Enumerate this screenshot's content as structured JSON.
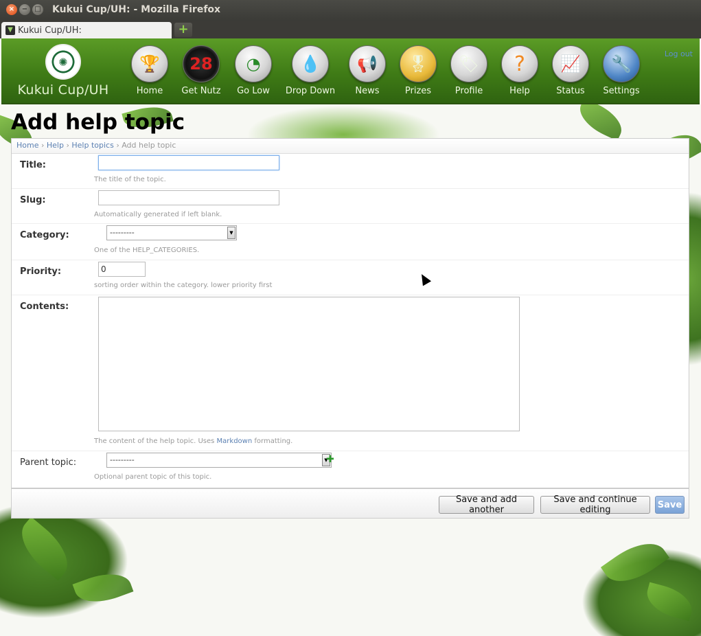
{
  "window": {
    "title": "Kukui Cup/UH: - Mozilla Firefox"
  },
  "tab": {
    "label": "Kukui Cup/UH:"
  },
  "header": {
    "brand": "Kukui Cup/UH",
    "logout": "Log out",
    "nav": [
      {
        "label": "Home",
        "icon": "trophy-icon",
        "glyph": "🏆"
      },
      {
        "label": "Get Nutz",
        "icon": "counter-icon",
        "glyph": "28"
      },
      {
        "label": "Go Low",
        "icon": "gauge-icon",
        "glyph": "◔"
      },
      {
        "label": "Drop Down",
        "icon": "water-drop-icon",
        "glyph": "💧"
      },
      {
        "label": "News",
        "icon": "megaphone-icon",
        "glyph": "📢"
      },
      {
        "label": "Prizes",
        "icon": "ribbon-icon",
        "glyph": "🎖"
      },
      {
        "label": "Profile",
        "icon": "profile-icon",
        "glyph": "🏷"
      },
      {
        "label": "Help",
        "icon": "help-icon",
        "glyph": "?"
      },
      {
        "label": "Status",
        "icon": "chart-icon",
        "glyph": "📈"
      },
      {
        "label": "Settings",
        "icon": "wrench-icon",
        "glyph": "🔧"
      }
    ]
  },
  "page": {
    "title": "Add help topic"
  },
  "breadcrumb": {
    "home": "Home",
    "help": "Help",
    "topics": "Help topics",
    "current": "Add help topic",
    "sep": "›"
  },
  "form": {
    "title": {
      "label": "Title:",
      "value": "",
      "help": "The title of the topic."
    },
    "slug": {
      "label": "Slug:",
      "value": "",
      "help": "Automatically generated if left blank."
    },
    "category": {
      "label": "Category:",
      "selected": "---------",
      "help": "One of the HELP_CATEGORIES."
    },
    "priority": {
      "label": "Priority:",
      "value": "0",
      "help": "sorting order within the category. lower priority first"
    },
    "contents": {
      "label": "Contents:",
      "help_pre": "The content of the help topic. Uses",
      "help_link": "Markdown",
      "help_post": "formatting."
    },
    "parent": {
      "label": "Parent topic:",
      "selected": "---------",
      "help": "Optional parent topic of this topic."
    }
  },
  "actions": {
    "save_add": "Save and add another",
    "save_continue": "Save and continue editing",
    "save": "Save"
  }
}
